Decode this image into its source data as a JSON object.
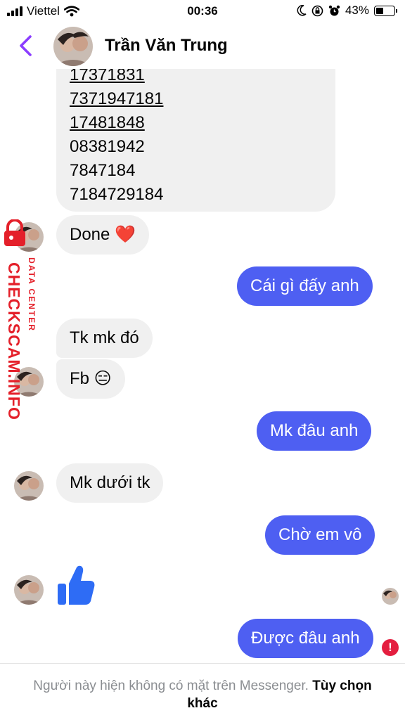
{
  "status_bar": {
    "carrier": "Viettel",
    "time": "00:36",
    "battery": "43%",
    "battery_level": 0.43
  },
  "header": {
    "contact_name": "Trần Văn Trung"
  },
  "messages": {
    "codes": [
      "17371831",
      "7371947181",
      "17481848",
      "08381942",
      "7847184",
      "7184729184"
    ],
    "done": "Done ❤️",
    "m1": "Cái gì đấy anh",
    "m2": "Tk mk đó",
    "m3": "Fb 😑",
    "m4": "Mk đâu anh",
    "m5": "Mk dưới tk",
    "m6": "Chờ em vô",
    "m7": "Được đâu anh"
  },
  "watermark": {
    "main": "CHECKSCAM.INFO",
    "sub": "DATA CENTER"
  },
  "footer": {
    "notice": "Người này hiện không có mặt trên Messenger.",
    "option": "Tùy chọn khác"
  },
  "colors": {
    "accent": "#8b3dff",
    "outgoing_bubble": "#4e5ff2",
    "incoming_bubble": "#f0f0f0",
    "like": "#2e6cf5",
    "error": "#e41e3f",
    "watermark": "#e4202a"
  },
  "icons": [
    "wifi-icon",
    "moon-icon",
    "rotation-lock-icon",
    "alarm-icon",
    "battery-icon",
    "back-arrow-icon",
    "thumbs-up-icon",
    "error-icon"
  ]
}
